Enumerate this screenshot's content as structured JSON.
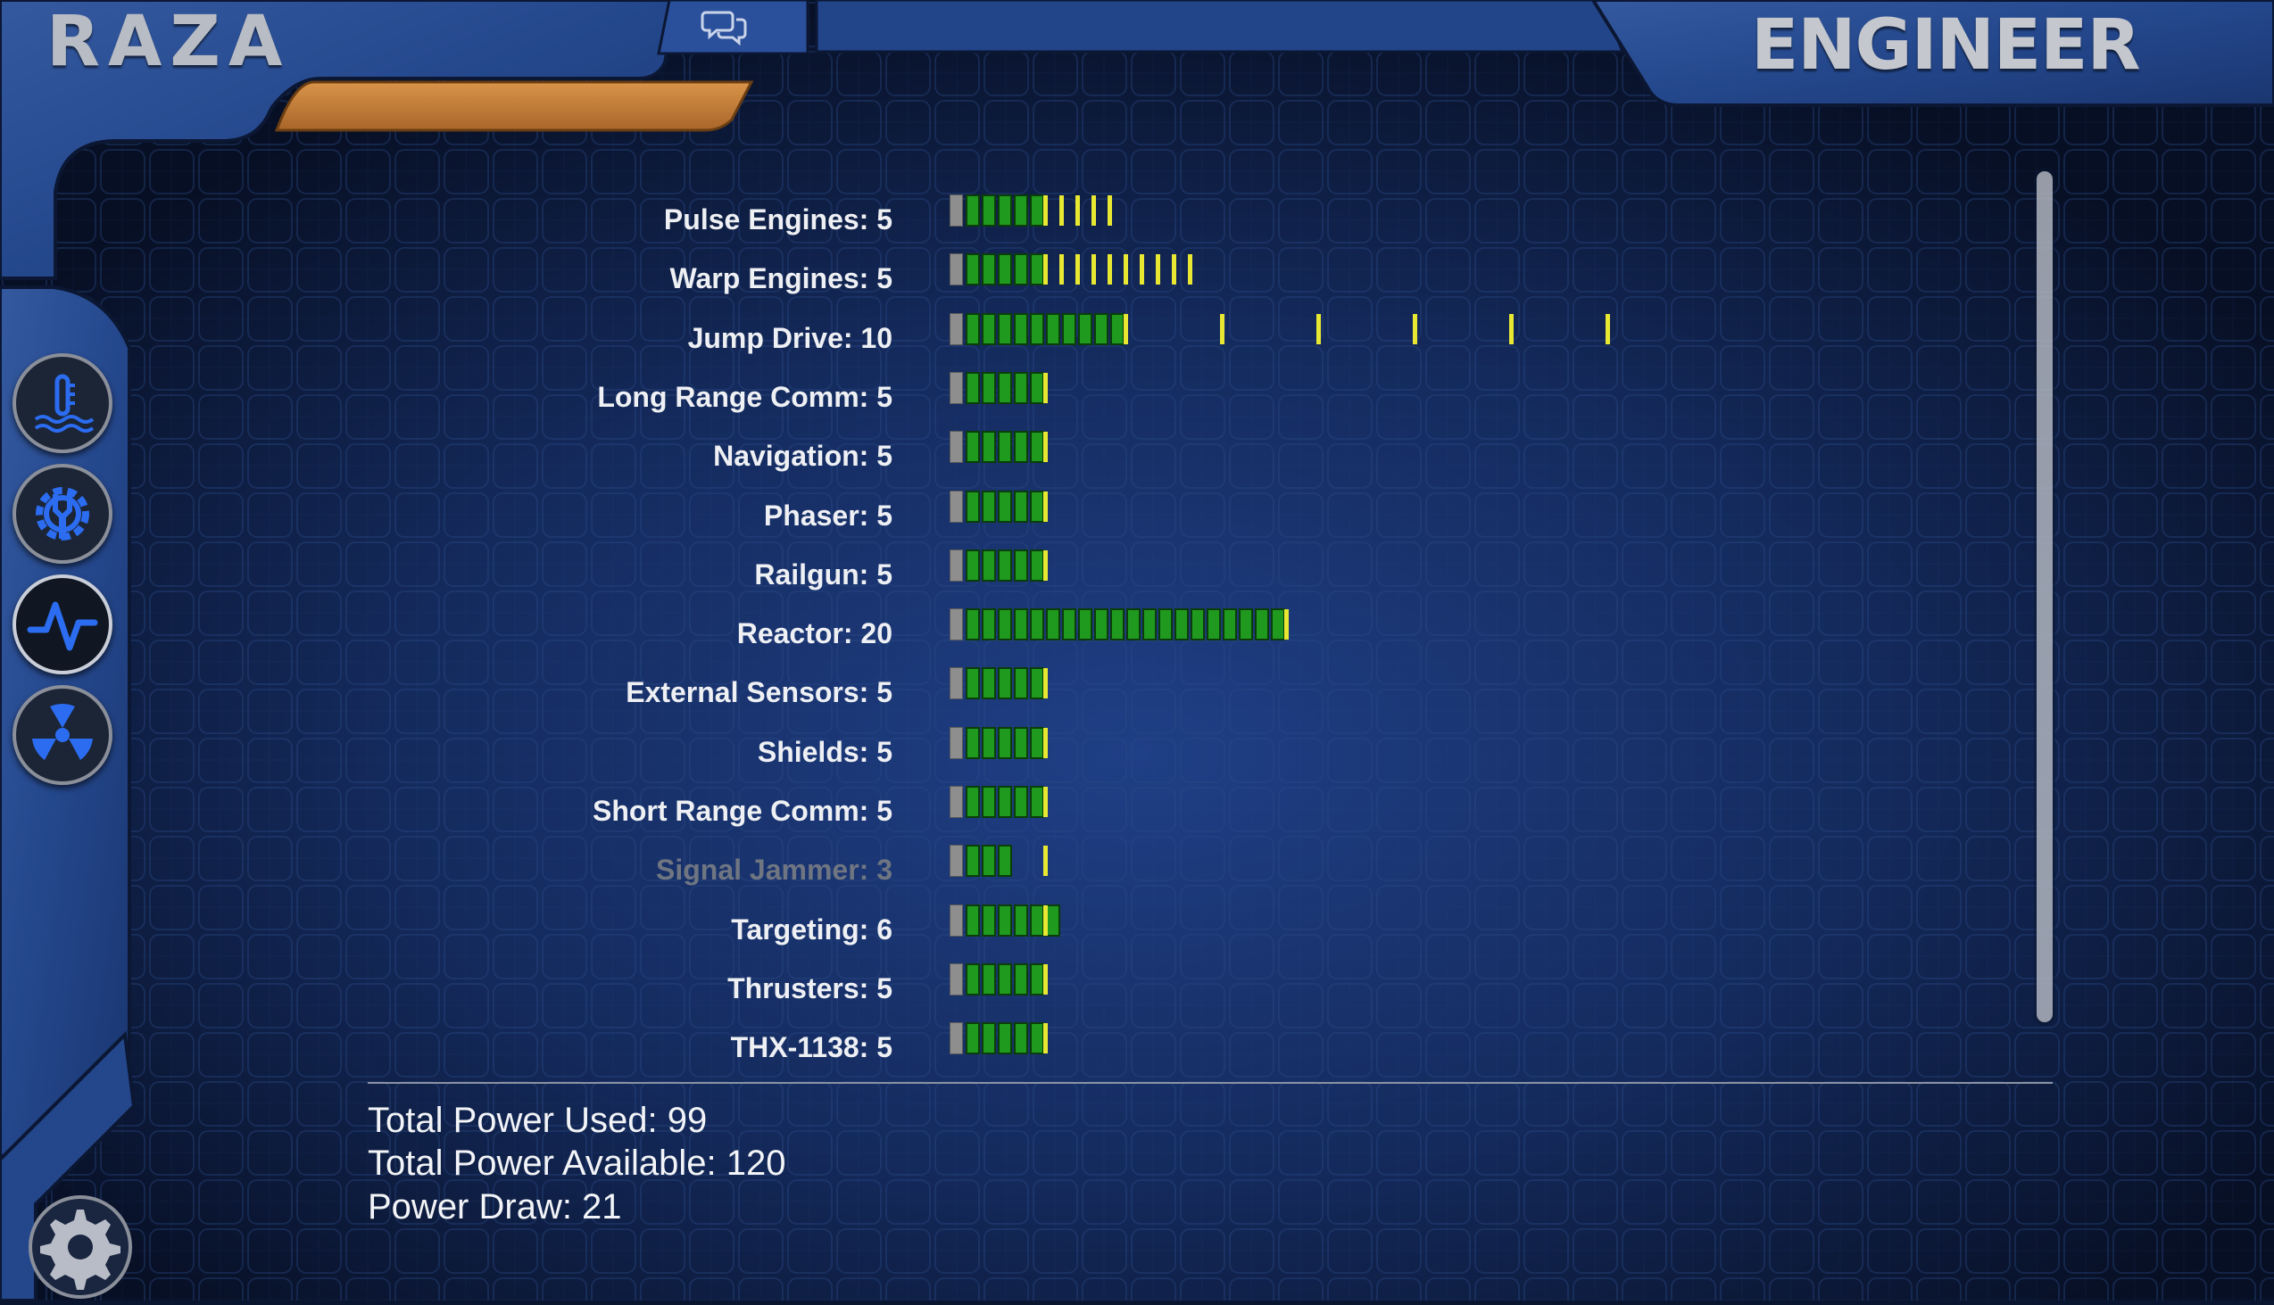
{
  "header": {
    "brand": "RAZA",
    "station": "ENGINEER"
  },
  "icons": {
    "comm": "chat-bubbles-icon",
    "nav": [
      "thermometer-icon",
      "wrench-gear-icon",
      "heartbeat-icon",
      "radiation-icon"
    ],
    "settings": "gear-icon"
  },
  "colors": {
    "frame_blue": "#2a4f9b",
    "accent_orange": "#c8813a",
    "segment_green": "#1f9a1f",
    "segment_yellow": "#e8e832",
    "segment_gray": "#8e8e8e",
    "active_icon_blue": "#2b6cf0"
  },
  "systems": [
    {
      "label": "Pulse Engines: 5",
      "power": 5,
      "extra_ticks": 4,
      "tick_spacing": 1,
      "dim": false
    },
    {
      "label": "Warp Engines: 5",
      "power": 5,
      "extra_ticks": 9,
      "tick_spacing": 1,
      "dim": false
    },
    {
      "label": "Jump Drive: 10",
      "power": 10,
      "extra_ticks": 5,
      "tick_spacing": 6,
      "dim": false
    },
    {
      "label": "Long Range Comm: 5",
      "power": 5,
      "extra_ticks": 0,
      "tick_spacing": 1,
      "dim": false
    },
    {
      "label": "Navigation: 5",
      "power": 5,
      "extra_ticks": 0,
      "tick_spacing": 1,
      "dim": false
    },
    {
      "label": "Phaser: 5",
      "power": 5,
      "extra_ticks": 0,
      "tick_spacing": 1,
      "dim": false
    },
    {
      "label": "Railgun: 5",
      "power": 5,
      "extra_ticks": 0,
      "tick_spacing": 1,
      "dim": false
    },
    {
      "label": "Reactor: 20",
      "power": 20,
      "extra_ticks": 0,
      "tick_spacing": 1,
      "dim": false
    },
    {
      "label": "External Sensors: 5",
      "power": 5,
      "extra_ticks": 0,
      "tick_spacing": 1,
      "dim": false
    },
    {
      "label": "Shields: 5",
      "power": 5,
      "extra_ticks": 0,
      "tick_spacing": 1,
      "dim": false
    },
    {
      "label": "Short Range Comm: 5",
      "power": 5,
      "extra_ticks": 0,
      "tick_spacing": 1,
      "dim": false
    },
    {
      "label": "Signal Jammer: 3",
      "power": 3,
      "requested": 5,
      "extra_ticks": 0,
      "tick_spacing": 1,
      "dim": true
    },
    {
      "label": "Targeting: 6",
      "power": 6,
      "extra_ticks": 0,
      "tick_spacing": 1,
      "dim": false
    },
    {
      "label": "Thrusters: 5",
      "power": 5,
      "extra_ticks": 0,
      "tick_spacing": 1,
      "dim": false
    },
    {
      "label": "THX-1138: 5",
      "power": 5,
      "extra_ticks": 0,
      "tick_spacing": 1,
      "dim": false
    }
  ],
  "totals": {
    "used": "Total Power Used: 99",
    "available": "Total Power Available: 120",
    "draw": "Power Draw: 21"
  }
}
